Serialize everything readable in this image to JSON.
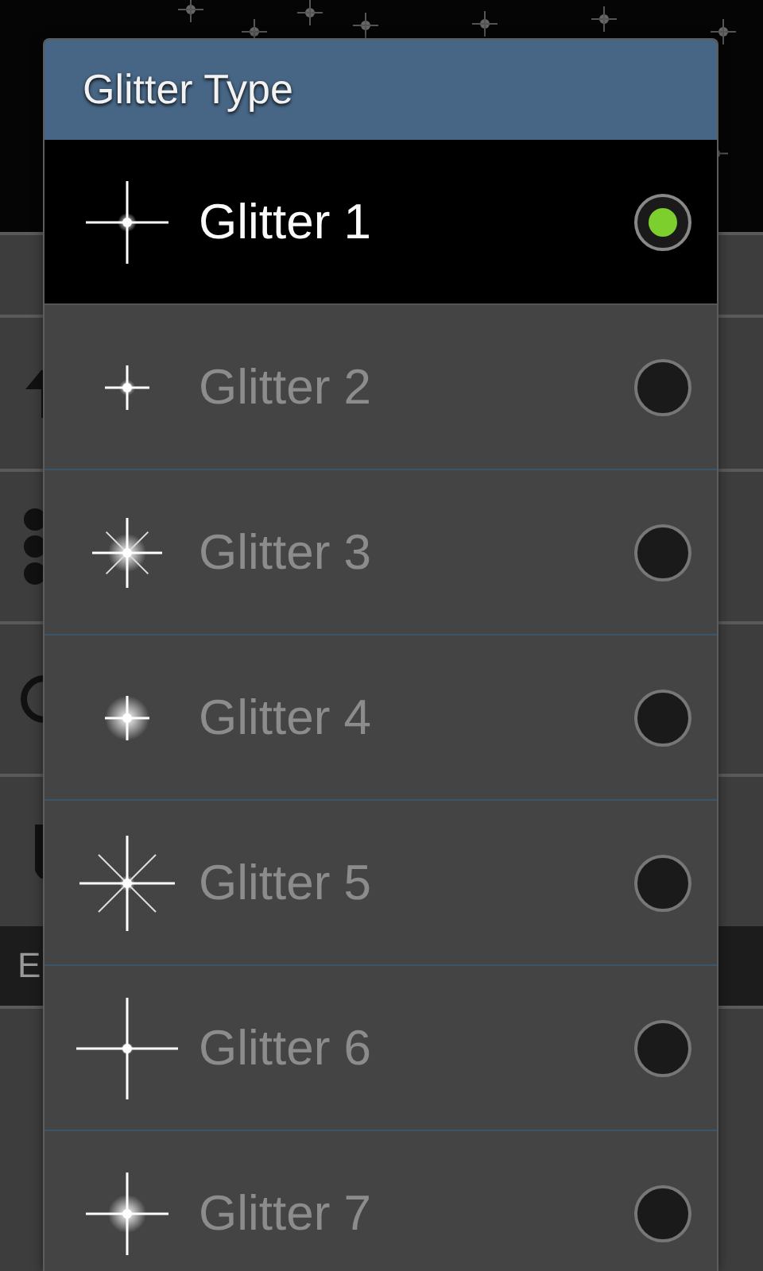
{
  "background": {
    "section_header": "E"
  },
  "dialog": {
    "title": "Glitter Type",
    "items": [
      {
        "label": "Glitter 1",
        "selected": true
      },
      {
        "label": "Glitter 2",
        "selected": false
      },
      {
        "label": "Glitter 3",
        "selected": false
      },
      {
        "label": "Glitter 4",
        "selected": false
      },
      {
        "label": "Glitter 5",
        "selected": false
      },
      {
        "label": "Glitter 6",
        "selected": false
      },
      {
        "label": "Glitter 7",
        "selected": false
      }
    ]
  }
}
